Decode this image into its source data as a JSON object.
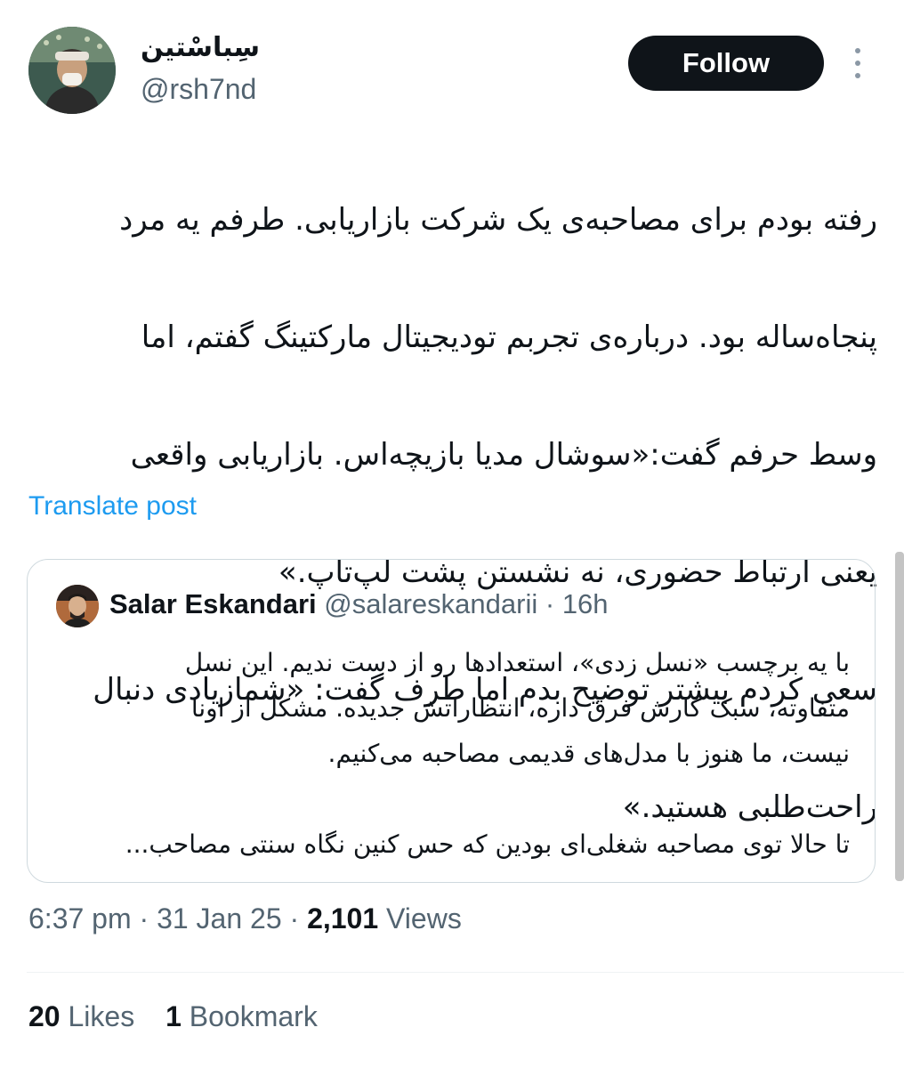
{
  "author": {
    "display_name": "سِباسْتین",
    "handle": "@rsh7nd"
  },
  "follow_button": "Follow",
  "post": {
    "lines": [
      "رفته بودم برای مصاحبه‌ی یک شرکت بازاریابی. طرفم یه مرد",
      "پنجاه‌ساله بود. درباره‌ی تجربم تودیجیتال مارکتینگ گفتم، اما",
      "وسط حرفم گفت:«سوشال مدیا بازیچه‌اس. بازاریابی واقعی",
      "یعنی ارتباط حضوری، نه نشستن پشت لپ‌تاپ.»",
      "سعی کردم بیشتر توضیح بدم اما طرف گفت: «شمازیادی دنبال",
      "راحت‌طلبی هستید.»"
    ]
  },
  "translate_label": "Translate post",
  "quote": {
    "name": "Salar Eskandari",
    "handle": "@salareskandarii",
    "separator": "·",
    "time": "16h",
    "lines": [
      "با یه برچسب «نسل زدی»، استعدادها رو از دست ندیم. این نسل",
      "متفاوته، سبک کارش فرق داره، انتظاراتش جدیده. مشکل از اونا",
      "نیست، ما هنوز با مدل‌های قدیمی مصاحبه می‌کنیم.",
      "تا حالا توی مصاحبه شغلی‌ای بودین که حس کنین نگاه سنتی مصاحب..."
    ]
  },
  "meta": {
    "time": "6:37 pm",
    "sep": "·",
    "date": "31 Jan 25",
    "views_count": "2,101",
    "views_label": "Views"
  },
  "stats": {
    "likes_count": "20",
    "likes_label": "Likes",
    "bookmarks_count": "1",
    "bookmarks_label": "Bookmark"
  }
}
